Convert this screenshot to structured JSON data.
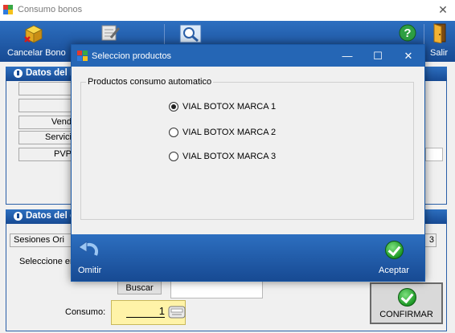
{
  "window": {
    "title": "Consumo bonos"
  },
  "toolbar": {
    "cancel_label": "Cancelar Bono",
    "exit_label": "Salir"
  },
  "sections": {
    "bono_header": "Datos del b",
    "consumo_header": "Datos del c"
  },
  "bono_fields": {
    "row3": "Vend",
    "row4": "Servici",
    "row5": "PVP"
  },
  "consumo": {
    "sesiones_label": "Sesiones Ori",
    "sesiones_value": "3",
    "seleccione_label": "Seleccione en",
    "buscar_label": "Buscar",
    "consumo_label": "Consumo:",
    "consumo_value": "1",
    "confirmar_label": "CONFIRMAR"
  },
  "dialog": {
    "title": "Seleccion productos",
    "group_label": "Productos consumo automatico",
    "options": [
      {
        "label": "VIAL BOTOX MARCA 1",
        "selected": true
      },
      {
        "label": "VIAL BOTOX MARCA 2",
        "selected": false
      },
      {
        "label": "VIAL BOTOX MARCA 3",
        "selected": false
      }
    ],
    "omit_label": "Omitir",
    "accept_label": "Aceptar"
  },
  "colors": {
    "toolbar_blue": "#1f5aa8",
    "dialog_title_blue": "#2566b5",
    "accept_green": "#1e9a27",
    "input_yellow": "#fff3a8"
  },
  "icons": {
    "cancel": "box-delete-icon",
    "edit": "notepad-icon",
    "search": "magnifier-icon",
    "help": "help-icon",
    "exit": "door-exit-icon",
    "omit": "undo-arrow-icon",
    "accept": "check-icon"
  }
}
